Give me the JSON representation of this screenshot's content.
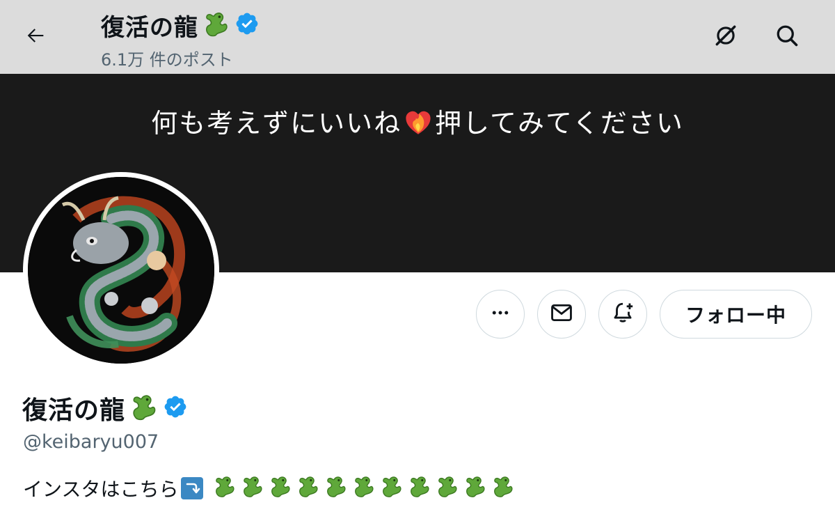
{
  "header": {
    "title": "復活の龍",
    "post_count": "6.1万 件のポスト",
    "icons": {
      "back": "back-arrow-icon",
      "grok": "grok-icon",
      "search": "search-icon"
    }
  },
  "banner": {
    "text_before": "何も考えずにいいね",
    "text_after": "押してみてください"
  },
  "profile": {
    "name": "復活の龍",
    "handle": "@keibaryu007",
    "bio_text": "インスタはこちら",
    "verified": true,
    "dragon_emoji_count": 11
  },
  "actions": {
    "more_label": "•••",
    "follow_label": "フォロー中"
  },
  "colors": {
    "verified": "#1d9bf0",
    "banner": "#1a1a1a",
    "topbar": "#dcdcdc",
    "dragon_green": "#5fa83a",
    "heart_fire": "#e83a3a"
  }
}
